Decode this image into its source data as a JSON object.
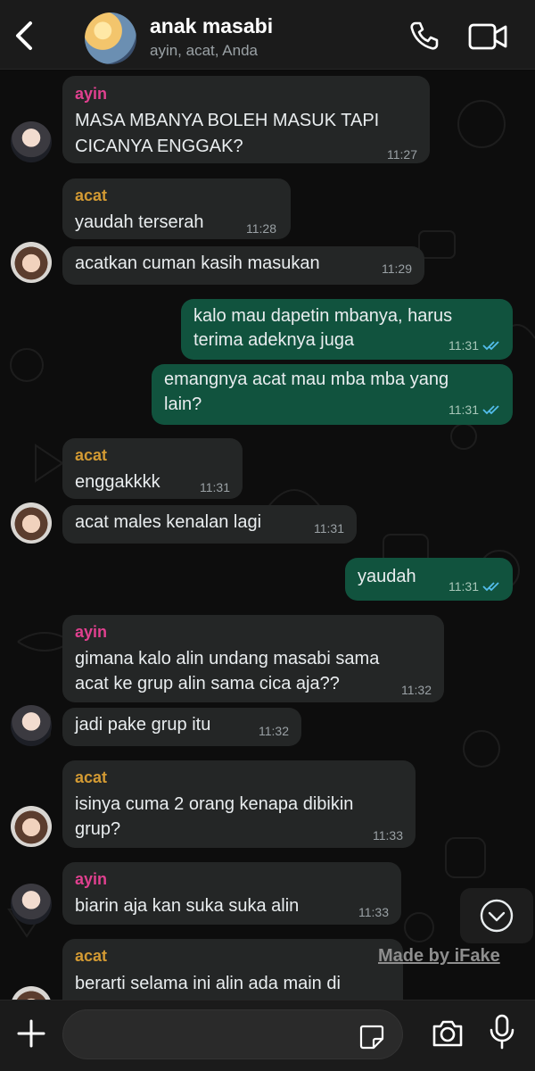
{
  "header": {
    "title": "anak masabi",
    "subtitle": "ayin, acat, Anda"
  },
  "colors": {
    "sender_ayin": "#e0408f",
    "sender_acat": "#d39a33",
    "outgoing_bubble": "#11533e",
    "incoming_bubble": "#242626",
    "read_ticks": "#53bdeb"
  },
  "messages": [
    {
      "sender": "ayin",
      "lines": [
        "MASA MBANYA BOLEH MASUK TAPI",
        "CICANYA ENGGAK?"
      ],
      "time": "11:27"
    },
    {
      "sender": "acat",
      "lines": [
        "yaudah terserah"
      ],
      "time": "11:28"
    },
    {
      "lines": [
        "acatkan cuman kasih masukan"
      ],
      "time": "11:29"
    },
    {
      "lines": [
        "kalo mau dapetin mbanya, harus",
        "terima adeknya juga"
      ],
      "time": "11:31"
    },
    {
      "lines": [
        "emangnya acat mau mba mba yang",
        "lain?"
      ],
      "time": "11:31"
    },
    {
      "sender": "acat",
      "lines": [
        "enggakkkk"
      ],
      "time": "11:31"
    },
    {
      "lines": [
        "acat males kenalan lagi"
      ],
      "time": "11:31"
    },
    {
      "lines": [
        "yaudah"
      ],
      "time": "11:31"
    },
    {
      "sender": "ayin",
      "lines": [
        "gimana kalo alin undang masabi sama",
        "acat ke grup alin sama cica aja??"
      ],
      "time": "11:32"
    },
    {
      "lines": [
        "jadi pake grup itu"
      ],
      "time": "11:32"
    },
    {
      "sender": "acat",
      "lines": [
        "isinya cuma 2 orang kenapa dibikin",
        "grup?"
      ],
      "time": "11:33"
    },
    {
      "sender": "ayin",
      "lines": [
        "biarin aja kan suka suka alin"
      ],
      "time": "11:33"
    },
    {
      "sender": "acat",
      "lines": [
        "berarti selama ini alin ada main di"
      ],
      "time": ""
    }
  ],
  "watermark": "Made by iFake",
  "icons": {
    "back": "chevron-left-icon",
    "call": "phone-icon",
    "video": "video-camera-icon",
    "scroll": "chevron-down-circle-icon",
    "attach": "plus-icon",
    "sticker": "sticker-icon",
    "camera": "camera-icon",
    "mic": "microphone-icon"
  }
}
